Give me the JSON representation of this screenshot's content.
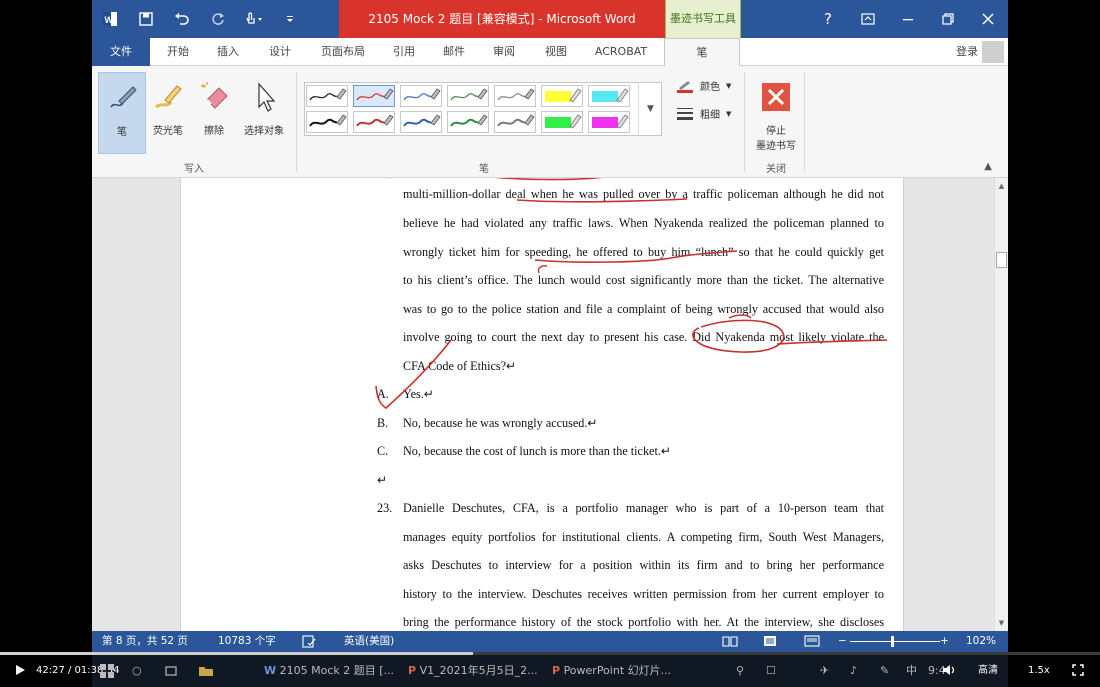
{
  "app": {
    "title": "2105 Mock 2 题目 [兼容模式] - Microsoft Word",
    "context_tab": "墨迹书写工具",
    "login": "登录"
  },
  "tabs": [
    "文件",
    "开始",
    "插入",
    "设计",
    "页面布局",
    "引用",
    "邮件",
    "审阅",
    "视图",
    "ACROBAT",
    "笔"
  ],
  "ribbon": {
    "pen": "笔",
    "highlighter": "荧光笔",
    "eraser": "擦除",
    "select_objects": "选择对象",
    "group_write": "写入",
    "group_pens": "笔",
    "color": "颜色",
    "thickness": "粗细",
    "stop_inking_1": "停止",
    "stop_inking_2": "墨迹书写",
    "group_close": "关闭"
  },
  "pen_colors": {
    "row1": [
      "#222222",
      "#d23a3a",
      "#4a74c4",
      "#5a8a5a",
      "#8a8a8a",
      "#ffff33",
      "#55e8f0"
    ],
    "row2": [
      "#111111",
      "#c83030",
      "#2f5fb5",
      "#2f8a3a",
      "#7a7a7a",
      "#33ee44",
      "#ee33ee"
    ]
  },
  "document": {
    "lines": [
      "multi-million-dollar deal when he was pulled over by a traffic policeman although he did not",
      "believe he had violated any traffic laws. When Nyakenda realized the policeman planned to",
      "wrongly ticket him for speeding, he offered to buy him “lunch” so that he could quickly get",
      "to his client’s office. The lunch would cost significantly more than the ticket. The alternative",
      "was to go to the police station and file a complaint of being wrongly accused that would also",
      "involve going to court the next day to present his case. Did Nyakenda most likely violate the",
      "CFA Code of Ethics?↵"
    ],
    "options": [
      {
        "letter": "A.",
        "text": "Yes.↵"
      },
      {
        "letter": "B.",
        "text": "No, because he was wrongly accused.↵"
      },
      {
        "letter": "C.",
        "text": "No, because the cost of lunch is more than the ticket.↵"
      }
    ],
    "blank": "↵",
    "q23_number": "23.",
    "q23_lines": [
      "Danielle Deschutes, CFA, is a portfolio manager who is part of a 10-person team that",
      "manages equity portfolios for institutional clients. A competing firm, South West Managers,",
      "asks Deschutes to interview for a position within its firm and to bring her performance",
      "history to the interview. Deschutes receives written permission from her current employer to",
      "bring the performance history of the stock portfolio with her. At the interview, she discloses"
    ]
  },
  "status": {
    "page": "第 8 页，共 52 页",
    "words": "10783 个字",
    "language": "英语(美国)",
    "zoom": "102%"
  },
  "player": {
    "time": "42:27 / 01:38:34",
    "progress": 0.43,
    "quality": "高清",
    "speed": "1.5x"
  },
  "taskbar": {
    "item1": "2105 Mock 2 题目 [...",
    "item2": "V1_2021年5月5日_2...",
    "item3": "PowerPoint 幻灯片...",
    "ime": "中",
    "clock": "9:4"
  }
}
